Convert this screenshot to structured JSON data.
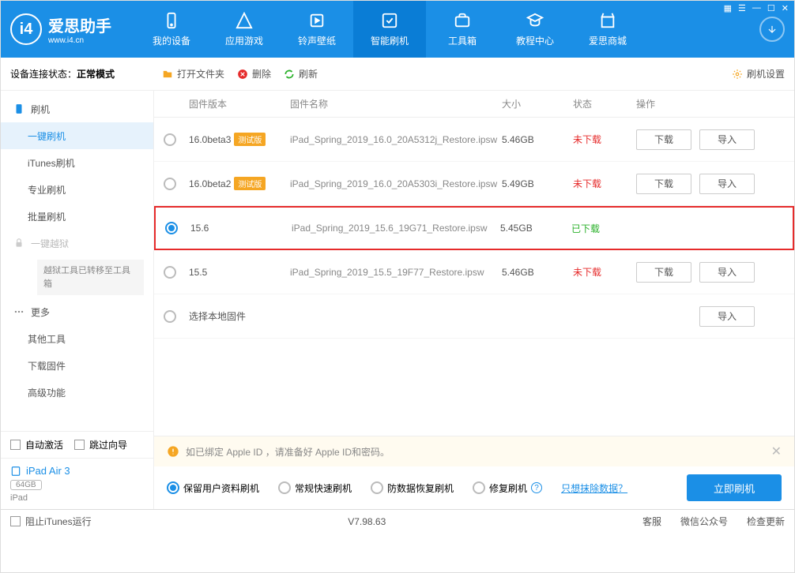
{
  "header": {
    "logo_title": "爱思助手",
    "logo_sub": "www.i4.cn",
    "nav": [
      {
        "label": "我的设备"
      },
      {
        "label": "应用游戏"
      },
      {
        "label": "铃声壁纸"
      },
      {
        "label": "智能刷机"
      },
      {
        "label": "工具箱"
      },
      {
        "label": "教程中心"
      },
      {
        "label": "爱思商城"
      }
    ]
  },
  "subheader": {
    "status_prefix": "设备连接状态：",
    "status_value": "正常模式",
    "open_folder": "打开文件夹",
    "delete": "删除",
    "refresh": "刷新",
    "flash_settings": "刷机设置"
  },
  "sidebar": {
    "flash": "刷机",
    "items": [
      "一键刷机",
      "iTunes刷机",
      "专业刷机",
      "批量刷机"
    ],
    "jailbreak": "一键越狱",
    "jailbreak_notice": "越狱工具已转移至工具箱",
    "more": "更多",
    "more_items": [
      "其他工具",
      "下载固件",
      "高级功能"
    ],
    "auto_activate": "自动激活",
    "skip_guide": "跳过向导"
  },
  "device": {
    "name": "iPad Air 3",
    "storage": "64GB",
    "type": "iPad"
  },
  "table": {
    "headers": {
      "version": "固件版本",
      "name": "固件名称",
      "size": "大小",
      "status": "状态",
      "action": "操作"
    },
    "rows": [
      {
        "version": "16.0beta3",
        "beta": "测试版",
        "name": "iPad_Spring_2019_16.0_20A5312j_Restore.ipsw",
        "size": "5.46GB",
        "status": "未下载",
        "downloaded": false,
        "selected": false
      },
      {
        "version": "16.0beta2",
        "beta": "测试版",
        "name": "iPad_Spring_2019_16.0_20A5303i_Restore.ipsw",
        "size": "5.49GB",
        "status": "未下载",
        "downloaded": false,
        "selected": false
      },
      {
        "version": "15.6",
        "beta": "",
        "name": "iPad_Spring_2019_15.6_19G71_Restore.ipsw",
        "size": "5.45GB",
        "status": "已下载",
        "downloaded": true,
        "selected": true
      },
      {
        "version": "15.5",
        "beta": "",
        "name": "iPad_Spring_2019_15.5_19F77_Restore.ipsw",
        "size": "5.46GB",
        "status": "未下载",
        "downloaded": false,
        "selected": false
      }
    ],
    "local_firmware": "选择本地固件",
    "btn_download": "下载",
    "btn_import": "导入"
  },
  "notice": "如已绑定 Apple ID ，请准备好 Apple ID和密码。",
  "options": {
    "opt1": "保留用户资料刷机",
    "opt2": "常规快速刷机",
    "opt3": "防数据恢复刷机",
    "opt4": "修复刷机",
    "erase_link": "只想抹除数据？",
    "flash_now": "立即刷机"
  },
  "footer": {
    "block_itunes": "阻止iTunes运行",
    "version": "V7.98.63",
    "links": [
      "客服",
      "微信公众号",
      "检查更新"
    ]
  }
}
